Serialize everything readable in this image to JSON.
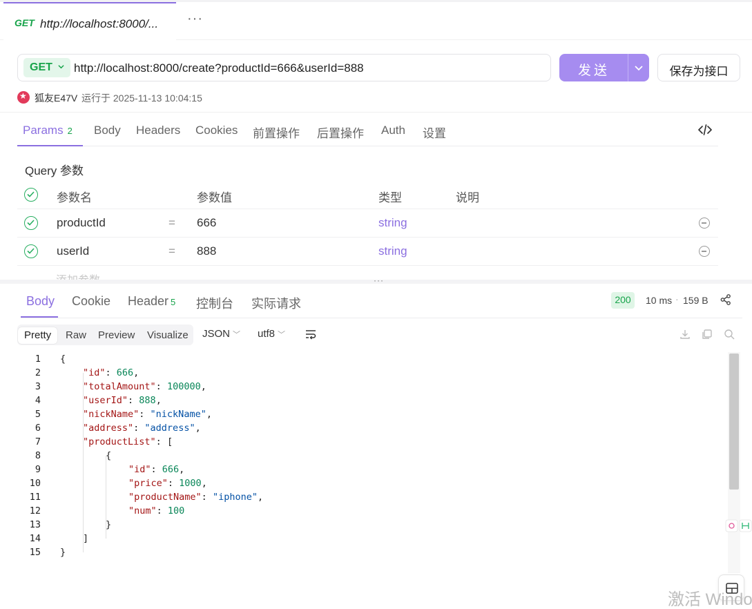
{
  "tab": {
    "method": "GET",
    "title": "http://localhost:8000/...",
    "more": "···"
  },
  "request": {
    "method": "GET",
    "url": "http://localhost:8000/create?productId=666&userId=888",
    "send_label": "发送",
    "save_label": "保存为接口"
  },
  "run_info": {
    "user": "狐友E47V",
    "time": "运行于 2025-11-13 10:04:15"
  },
  "req_tabs": [
    {
      "label": "Params",
      "count": "2"
    },
    {
      "label": "Body"
    },
    {
      "label": "Headers"
    },
    {
      "label": "Cookies"
    },
    {
      "label": "前置操作"
    },
    {
      "label": "后置操作"
    },
    {
      "label": "Auth"
    },
    {
      "label": "设置"
    }
  ],
  "params": {
    "title": "Query 参数",
    "headers": {
      "name": "参数名",
      "value": "参数值",
      "type": "类型",
      "desc": "说明"
    },
    "rows": [
      {
        "name": "productId",
        "eq": "=",
        "value": "666",
        "type": "string"
      },
      {
        "name": "userId",
        "eq": "=",
        "value": "888",
        "type": "string"
      }
    ],
    "add_placeholder": "添加参数"
  },
  "splitter": "···",
  "resp_tabs": [
    {
      "label": "Body"
    },
    {
      "label": "Cookie"
    },
    {
      "label": "Header",
      "count": "5"
    },
    {
      "label": "控制台"
    },
    {
      "label": "实际请求"
    }
  ],
  "response_meta": {
    "status": "200",
    "time": "10 ms",
    "dot": "·",
    "size": "159 B"
  },
  "view_modes": [
    "Pretty",
    "Raw",
    "Preview",
    "Visualize"
  ],
  "format": {
    "type": "JSON",
    "encoding": "utf8"
  },
  "code_lines": [
    "1",
    "2",
    "3",
    "4",
    "5",
    "6",
    "7",
    "8",
    "9",
    "10",
    "11",
    "12",
    "13",
    "14",
    "15"
  ],
  "json": {
    "open": "{",
    "id_key": "\"id\"",
    "id_val": "666",
    "total_key": "\"totalAmount\"",
    "total_val": "100000",
    "user_key": "\"userId\"",
    "user_val": "888",
    "nick_key": "\"nickName\"",
    "nick_val": "\"nickName\"",
    "addr_key": "\"address\"",
    "addr_val": "\"address\"",
    "list_key": "\"productList\"",
    "list_open": "[",
    "obj_open": "{",
    "pid_key": "\"id\"",
    "pid_val": "666",
    "price_key": "\"price\"",
    "price_val": "1000",
    "pname_key": "\"productName\"",
    "pname_val": "\"iphone\"",
    "num_key": "\"num\"",
    "num_val": "100",
    "obj_close": "}",
    "list_close": "]",
    "close": "}"
  },
  "watermark": "激活 Windo",
  "colors": {
    "accent": "#8b6fe0",
    "send": "#a68cf0",
    "get_green": "#17a34a"
  }
}
